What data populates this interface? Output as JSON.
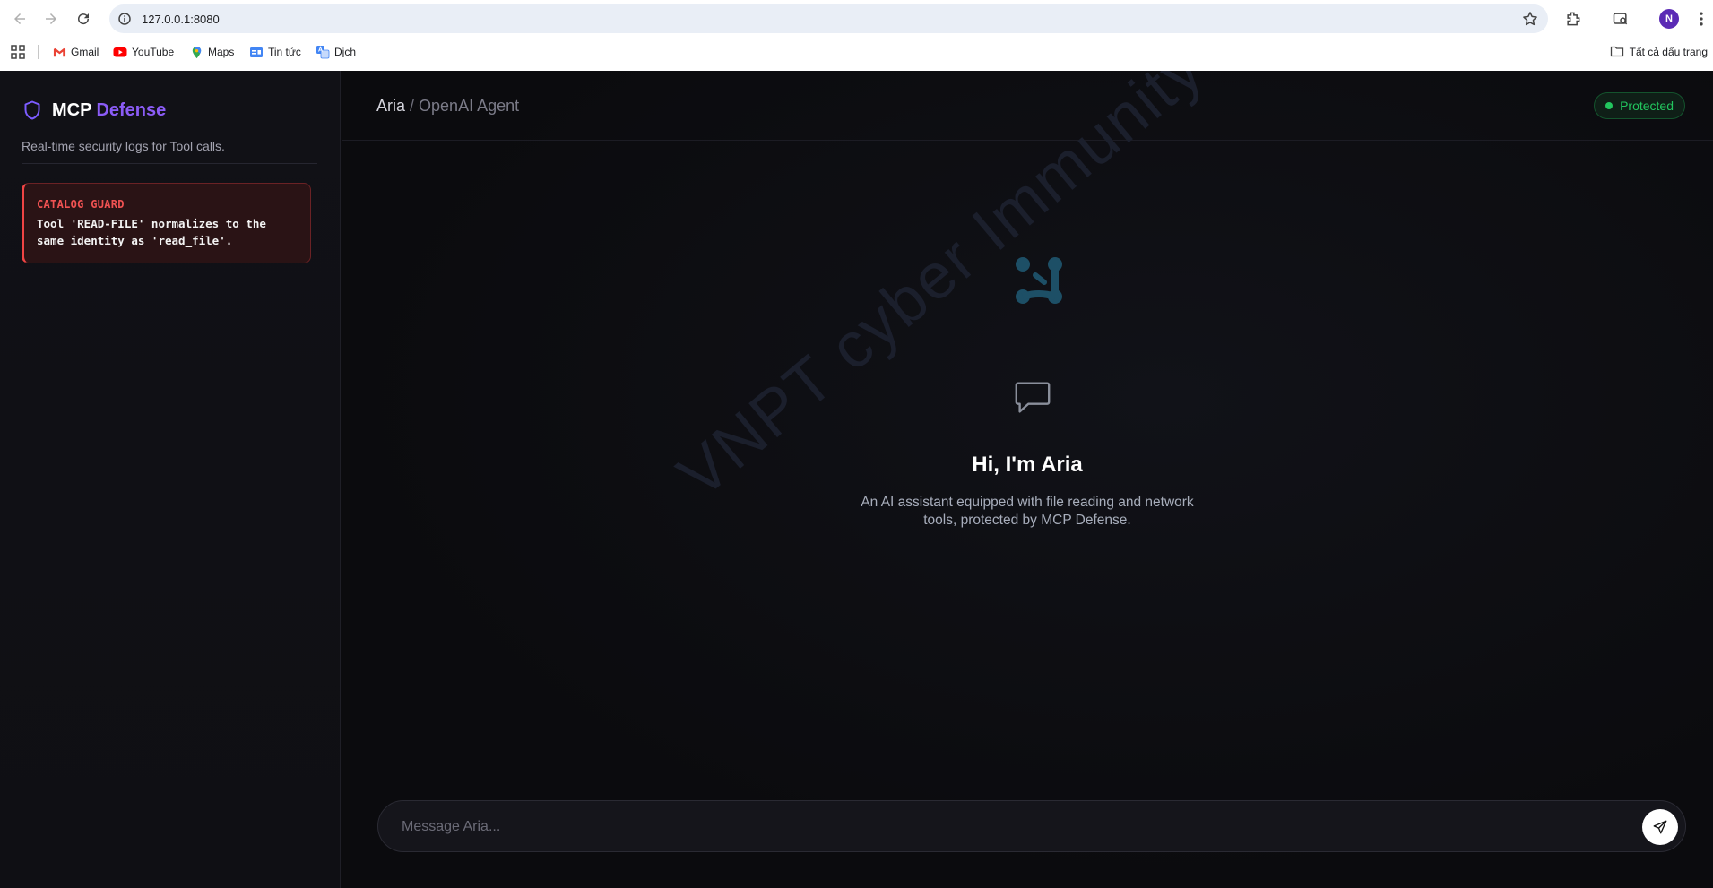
{
  "browser": {
    "url": "127.0.0.1:8080",
    "profile_initial": "N",
    "bookmarks": [
      {
        "label": "Gmail",
        "icon": "gmail-icon"
      },
      {
        "label": "YouTube",
        "icon": "youtube-icon"
      },
      {
        "label": "Maps",
        "icon": "maps-icon"
      },
      {
        "label": "Tin tức",
        "icon": "news-icon"
      },
      {
        "label": "Dịch",
        "icon": "translate-icon"
      }
    ],
    "all_bookmarks_label": "Tất cả dấu trang"
  },
  "sidebar": {
    "brand_primary": "MCP",
    "brand_accent": "Defense",
    "tagline": "Real-time security logs for Tool calls.",
    "alerts": [
      {
        "title": "CATALOG GUARD",
        "message": "Tool 'READ-FILE' normalizes to the same identity as 'read_file'."
      }
    ]
  },
  "header": {
    "agent_name": "Aria",
    "separator": "/",
    "agent_type": "OpenAI Agent",
    "status": "Protected"
  },
  "watermark": "VNPT cyber Immunity",
  "hero": {
    "title": "Hi, I'm Aria",
    "subtitle": "An AI assistant equipped with file reading and network tools, protected by MCP Defense."
  },
  "composer": {
    "placeholder": "Message Aria..."
  },
  "colors": {
    "accent": "#8b5cf6",
    "alert_red": "#ef4444",
    "status_green": "#22c55e",
    "background": "#0b0b0e"
  }
}
